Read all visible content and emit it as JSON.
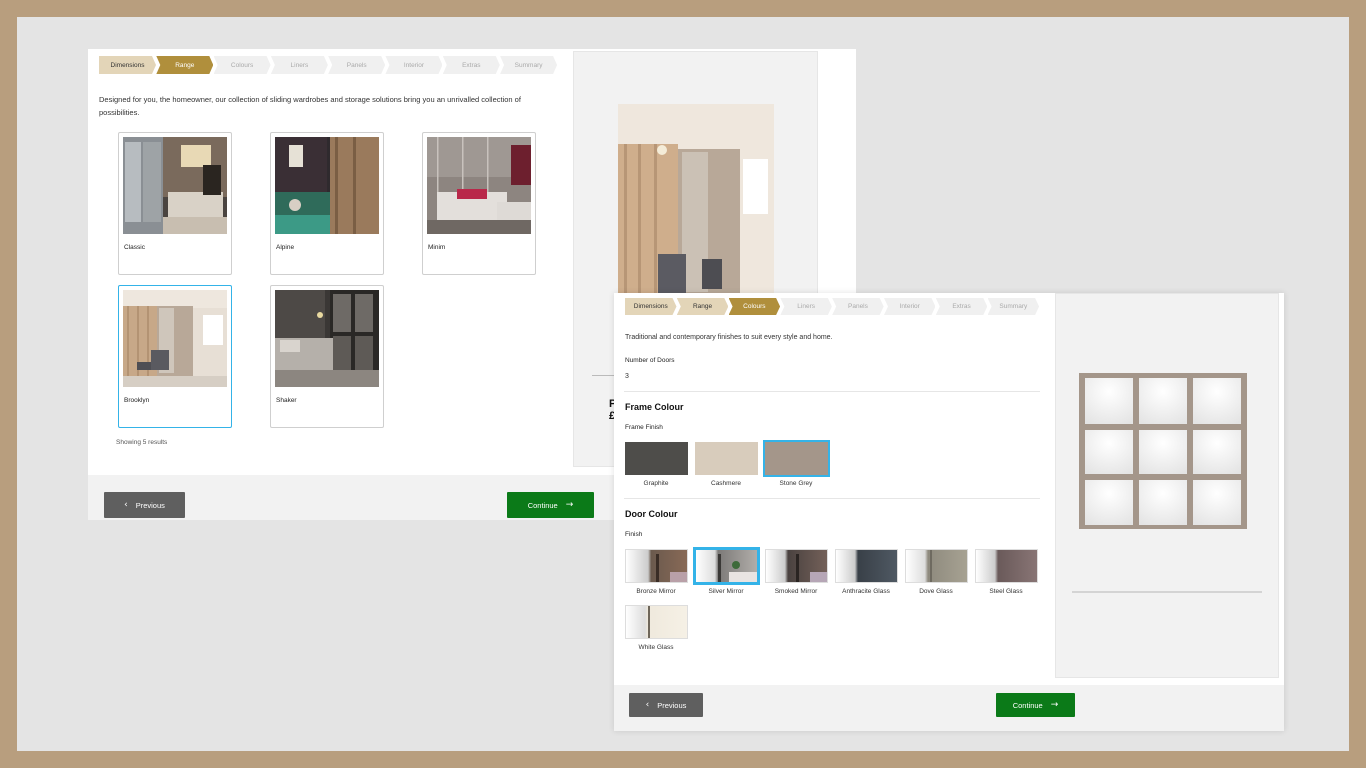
{
  "screen1": {
    "steps": [
      "Dimensions",
      "Range",
      "Colours",
      "Liners",
      "Panels",
      "Interior",
      "Extras",
      "Summary"
    ],
    "intro": "Designed for you, the homeowner, our collection of sliding wardrobes and storage solutions bring you an unrivalled collection of possibilities.",
    "ranges": [
      "Classic",
      "Alpine",
      "Minim",
      "Brooklyn",
      "Shaker"
    ],
    "selected_range": "Brooklyn",
    "results": "Showing 5 results",
    "price_fragment_1": "P",
    "price_fragment_2": "£",
    "prev_label": "Previous",
    "continue_label": "Continue"
  },
  "screen2": {
    "steps": [
      "Dimensions",
      "Range",
      "Colours",
      "Liners",
      "Panels",
      "Interior",
      "Extras",
      "Summary"
    ],
    "intro": "Traditional and contemporary finishes to suit every style and home.",
    "doors_label": "Number of Doors",
    "doors_value": "3",
    "frame_colour_heading": "Frame Colour",
    "frame_finish_label": "Frame Finish",
    "frame_finishes": [
      {
        "name": "Graphite",
        "color": "#4e4d4a"
      },
      {
        "name": "Cashmere",
        "color": "#d8ccbc"
      },
      {
        "name": "Stone Grey",
        "color": "#a4968a"
      }
    ],
    "door_colour_heading": "Door Colour",
    "door_finish_label": "Finish",
    "door_finishes": [
      "Bronze Mirror",
      "Silver Mirror",
      "Smoked Mirror",
      "Anthracite Glass",
      "Dove Glass",
      "Steel Glass",
      "White Glass"
    ],
    "prev_label": "Previous",
    "continue_label": "Continue"
  },
  "colors": {
    "accent_gold": "#b08f3c",
    "step_done": "#e3d5b8",
    "continue_green": "#0b7a18",
    "selection_blue": "#34b3e8",
    "frame_preview": "#a4968a"
  }
}
